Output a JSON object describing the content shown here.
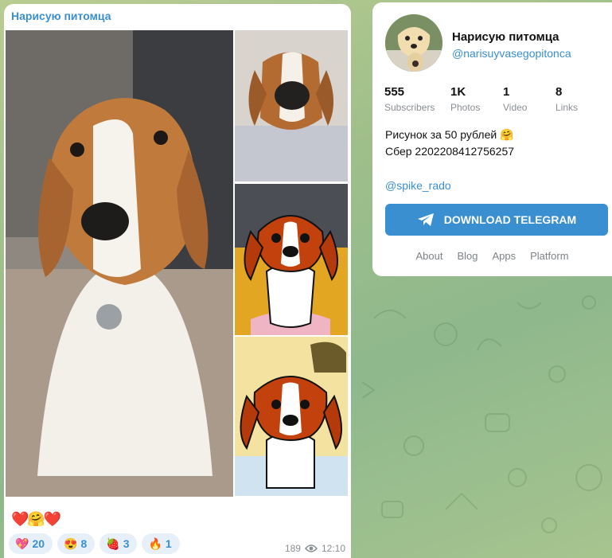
{
  "message": {
    "channel_title": "Нарисую питомца",
    "caption_emojis": "❤️🤗❤️",
    "reactions": [
      {
        "emoji": "💖",
        "count": "20"
      },
      {
        "emoji": "😍",
        "count": "8"
      },
      {
        "emoji": "🍓",
        "count": "3"
      },
      {
        "emoji": "🔥",
        "count": "1"
      }
    ],
    "views": "189",
    "time": "12:10"
  },
  "channel": {
    "name": "Нарисую питомца",
    "username": "@narisuyvasegopitonca",
    "stats": [
      {
        "value": "555",
        "label": "Subscribers"
      },
      {
        "value": "1K",
        "label": "Photos"
      },
      {
        "value": "1",
        "label": "Video"
      },
      {
        "value": "8",
        "label": "Links"
      }
    ],
    "description_line1": "Рисунок за 50 рублей 🤗",
    "description_line2": "Сбер 2202208412756257",
    "mention": "@spike_rado",
    "download_button": "DOWNLOAD TELEGRAM",
    "footer_links": [
      "About",
      "Blog",
      "Apps",
      "Platform"
    ]
  },
  "colors": {
    "accent": "#3a8fd1",
    "reaction_bg": "#e7f0f9"
  }
}
